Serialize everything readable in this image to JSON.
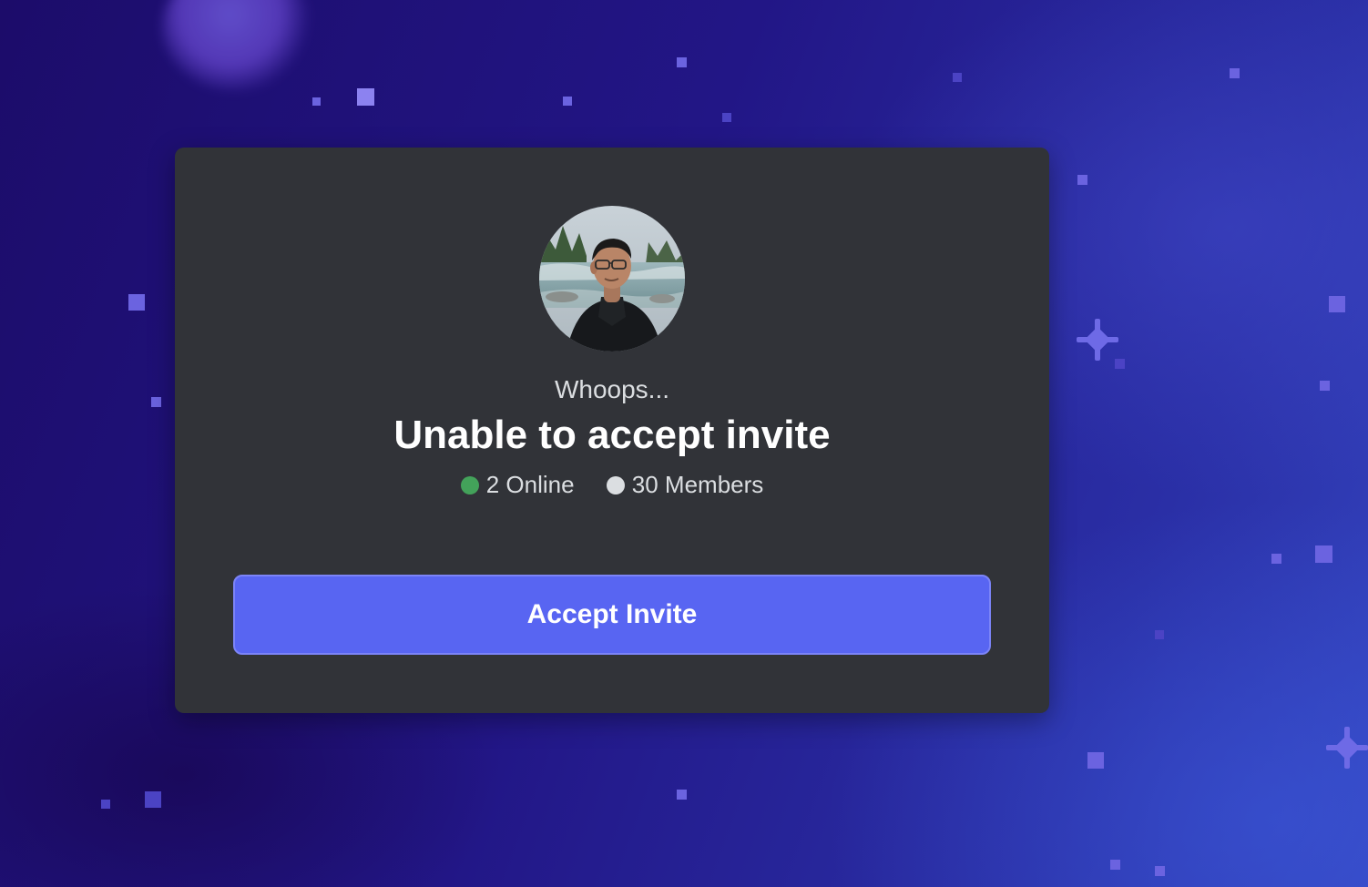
{
  "invite": {
    "subtitle": "Whoops...",
    "title": "Unable to accept invite",
    "online_count": "2 Online",
    "member_count": "30 Members",
    "accept_label": "Accept Invite"
  },
  "colors": {
    "card_background": "#313338",
    "accent": "#5865f2",
    "online_dot": "#43a25a",
    "members_dot": "#dbdee1"
  },
  "icons": [
    "server-avatar",
    "online-status-icon",
    "members-status-icon"
  ]
}
